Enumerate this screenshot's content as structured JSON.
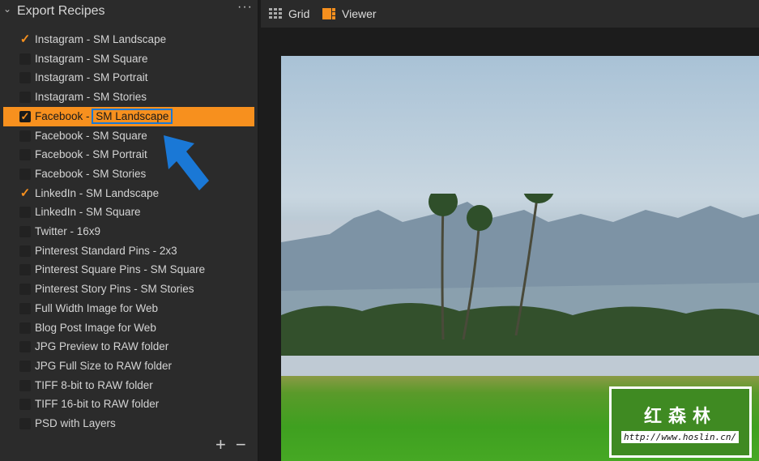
{
  "panel": {
    "title": "Export Recipes",
    "more": "···",
    "add": "+",
    "remove": "−"
  },
  "recipes": [
    {
      "label": "Instagram - SM Landscape",
      "checked": true
    },
    {
      "label": "Instagram - SM Square",
      "checked": false
    },
    {
      "label": "Instagram - SM Portrait",
      "checked": false
    },
    {
      "label": "Instagram - SM Stories",
      "checked": false
    },
    {
      "label_a": "Facebook - ",
      "label_b": "SM Landscape",
      "checked": true,
      "selected": true
    },
    {
      "label": "Facebook - SM Square",
      "checked": false
    },
    {
      "label": "Facebook - SM Portrait",
      "checked": false
    },
    {
      "label": "Facebook - SM Stories",
      "checked": false
    },
    {
      "label": "LinkedIn - SM Landscape",
      "checked": true
    },
    {
      "label": "LinkedIn - SM Square",
      "checked": false
    },
    {
      "label": "Twitter - 16x9",
      "checked": false
    },
    {
      "label": "Pinterest Standard Pins - 2x3",
      "checked": false
    },
    {
      "label": "Pinterest Square Pins - SM Square",
      "checked": false
    },
    {
      "label": "Pinterest Story Pins - SM Stories",
      "checked": false
    },
    {
      "label": "Full Width Image for Web",
      "checked": false
    },
    {
      "label": "Blog Post Image for Web",
      "checked": false
    },
    {
      "label": "JPG Preview to RAW folder",
      "checked": false
    },
    {
      "label": "JPG Full Size to RAW folder",
      "checked": false
    },
    {
      "label": "TIFF 8-bit to RAW folder",
      "checked": false
    },
    {
      "label": "TIFF 16-bit to RAW folder",
      "checked": false
    },
    {
      "label": "PSD with Layers",
      "checked": false
    }
  ],
  "toolbar": {
    "grid": "Grid",
    "viewer": "Viewer"
  },
  "watermark": {
    "name": "红森林",
    "url": "http://www.hoslin.cn/"
  },
  "colors": {
    "accent": "#f7901e",
    "annotation": "#1a78d6"
  }
}
